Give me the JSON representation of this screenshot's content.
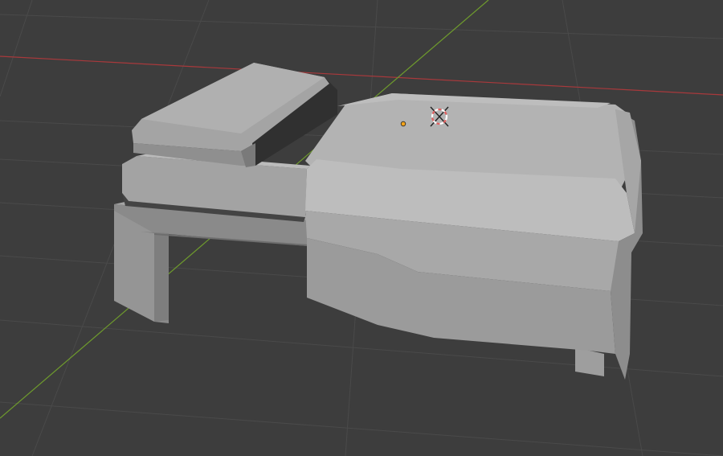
{
  "viewport": {
    "editor": "3D Viewport",
    "view": "perspective",
    "background_color": "#3d3d3d",
    "grid_line_color": "#4b4b4b",
    "x_axis_color": "#c2474a",
    "y_axis_color": "#7fb333"
  },
  "scene": {
    "objects": [
      {
        "id": "pillow",
        "kind": "mesh",
        "shading": "solid",
        "color": "#9a9a9a"
      },
      {
        "id": "bed-frame",
        "kind": "mesh",
        "shading": "solid",
        "color": "#9c9c9c"
      },
      {
        "id": "mattress",
        "kind": "mesh",
        "shading": "solid",
        "color": "#a9a9a9"
      },
      {
        "id": "blanket",
        "kind": "mesh",
        "shading": "solid",
        "color": "#b1b1b1"
      }
    ],
    "origin_dot_color": "#f3a31b",
    "cursor_3d": "3d-cursor-icon"
  }
}
